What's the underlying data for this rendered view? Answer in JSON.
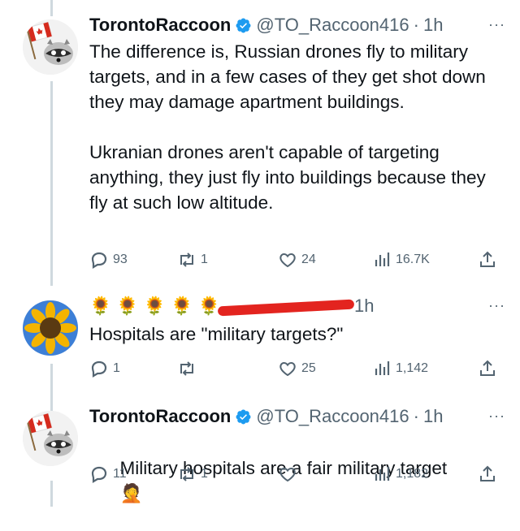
{
  "tweets": [
    {
      "name": "TorontoRaccoon",
      "handle": "@TO_Raccoon416",
      "dot": "·",
      "time": "1h",
      "more": "···",
      "text": "The difference is, Russian drones fly to military targets, and in a few cases of they get shot down they may damage apartment buildings.\n\nUkranian drones aren't capable of targeting anything, they just fly into buildings because they fly at such low altitude.",
      "replies": "93",
      "retweets": "1",
      "likes": "24",
      "views": "16.7K"
    },
    {
      "name_emojis": "🌻🌻🌻🌻🌻",
      "time": "1h",
      "more": "···",
      "text": "Hospitals are \"military targets?\"",
      "replies": "1",
      "retweets": "",
      "likes": "25",
      "views": "1,142"
    },
    {
      "name": "TorontoRaccoon",
      "handle": "@TO_Raccoon416",
      "dot": "·",
      "time": "1h",
      "more": "···",
      "text": "Military hospitals are a fair military target",
      "emoji": "🤦",
      "replies": "11",
      "retweets": "1",
      "likes": "",
      "views": "1,182"
    }
  ],
  "colors": {
    "verified": "#1d9bf0",
    "muted": "#536471",
    "line": "#cfd9de",
    "redaction": "#e3241f"
  }
}
